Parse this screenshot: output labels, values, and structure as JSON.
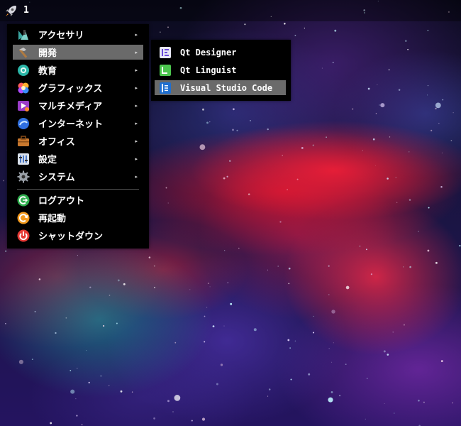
{
  "top_bar": {
    "workspace": "1",
    "launcher_icon": "rocket-icon"
  },
  "main_menu": {
    "items": [
      {
        "label": "アクセサリ",
        "icon": "accessories-icon",
        "has_submenu": true
      },
      {
        "label": "開発",
        "icon": "development-icon",
        "has_submenu": true,
        "active": true
      },
      {
        "label": "教育",
        "icon": "education-icon",
        "has_submenu": true
      },
      {
        "label": "グラフィックス",
        "icon": "graphics-icon",
        "has_submenu": true
      },
      {
        "label": "マルチメディア",
        "icon": "multimedia-icon",
        "has_submenu": true
      },
      {
        "label": "インターネット",
        "icon": "internet-icon",
        "has_submenu": true
      },
      {
        "label": "オフィス",
        "icon": "office-icon",
        "has_submenu": true
      },
      {
        "label": "設定",
        "icon": "settings-icon",
        "has_submenu": true
      },
      {
        "label": "システム",
        "icon": "system-icon",
        "has_submenu": true
      }
    ],
    "session_items": [
      {
        "label": "ログアウト",
        "icon": "logout-icon"
      },
      {
        "label": "再起動",
        "icon": "reboot-icon"
      },
      {
        "label": "シャットダウン",
        "icon": "shutdown-icon"
      }
    ],
    "submenu_arrow": "▸"
  },
  "submenu": {
    "items": [
      {
        "label": "Qt Designer",
        "icon": "qt-designer-icon"
      },
      {
        "label": "Qt Linguist",
        "icon": "qt-linguist-icon"
      },
      {
        "label": "Visual Studio Code",
        "icon": "vscode-icon",
        "active": true
      }
    ]
  },
  "colors": {
    "menu_bg": "#000000",
    "active_bg": "#6a6a6a",
    "text": "#ffffff"
  }
}
